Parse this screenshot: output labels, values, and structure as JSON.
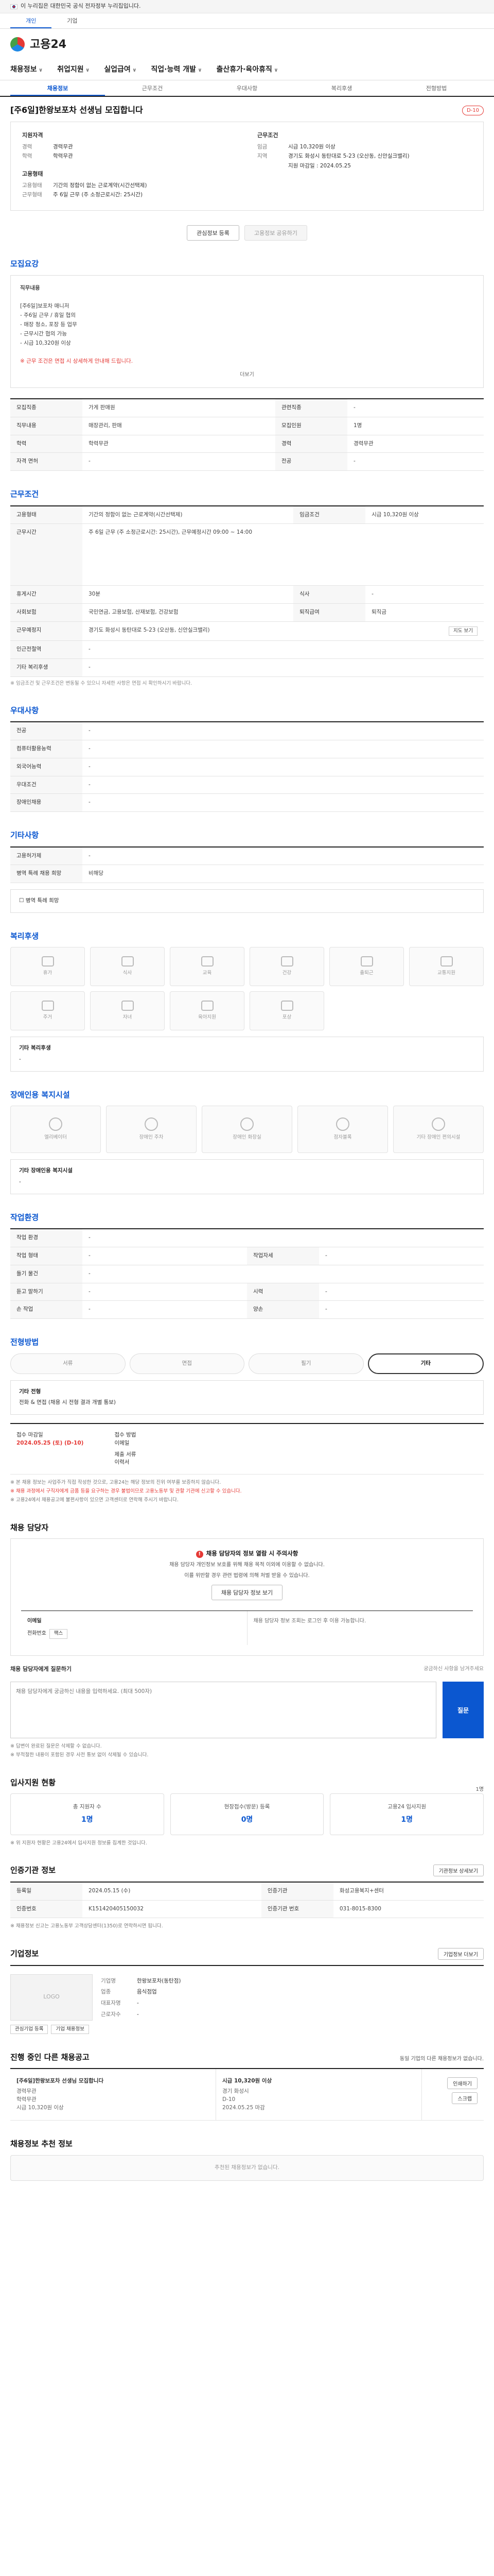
{
  "gov_banner": "이 누리집은 대한민국 공식 전자정부 누리집입니다.",
  "top_tabs": [
    "개인",
    "기업"
  ],
  "logo": "고용24",
  "gnb": [
    "채용정보",
    "취업지원",
    "실업급여",
    "직업·능력 개발",
    "출산휴가·육아휴직"
  ],
  "lnb": [
    "채용정보",
    "근무조건",
    "우대사항",
    "복리후생",
    "전형방법"
  ],
  "job": {
    "title": "[주6일]한왕보포차 선생님 모집합니다",
    "badge": "D-10",
    "company_title": "지원자격",
    "company_rows": [
      {
        "k": "경력",
        "v": "경력무관"
      },
      {
        "k": "학력",
        "v": "학력무관"
      }
    ],
    "work_title": "근무조건",
    "work_rows": [
      {
        "k": "임금",
        "v": "시급 10,320원 이상"
      },
      {
        "k": "지역",
        "v": "경기도 화성시 동탄대로 5-23 (오산동, 신안실크밸리)"
      },
      {
        "k": "",
        "v": "지원 마감일 : 2024.05.25"
      }
    ],
    "type_title": "고용형태",
    "type_rows": [
      {
        "k": "고용형태",
        "v": "기간의 정함이 없는 근로계약(시간선택제)"
      },
      {
        "k": "근무형태",
        "v": "주 6일 근무 (주 소정근로시간: 25시간)"
      }
    ]
  },
  "buttons": {
    "apply": "관심정보 등록",
    "share": "고용정보 공유하기"
  },
  "recruit": {
    "title": "모집요강",
    "desc_title": "직무내용",
    "desc_lines": [
      "[주6일]보포차 매니저",
      "- 주6일 근무 / 휴일 협의",
      "- 매장 청소, 포장 등 업무",
      "- 근무시간 협의 가능",
      "- 시급 10,320원 이상"
    ],
    "desc_note": "※ 근무 조건은 면접 시 상세하게 안내해 드립니다.",
    "more": "더보기",
    "rows": [
      {
        "k1": "모집직종",
        "v1": "가게 판매원",
        "k2": "관련직종",
        "v2": "-"
      },
      {
        "k1": "직무내용",
        "v1": "매장관리, 판매",
        "k2": "모집인원",
        "v2": "1명"
      },
      {
        "k1": "학력",
        "v1": "학력무관",
        "k2": "경력",
        "v2": "경력무관"
      },
      {
        "k1": "자격 면허",
        "v1": "-",
        "k2": "전공",
        "v2": "-"
      }
    ]
  },
  "conditions": {
    "title": "근무조건",
    "rows": [
      {
        "k": "고용형태",
        "v": "기간의 정함이 없는 근로계약(시간선택제)",
        "k2": "임금조건",
        "v2": "시급 10,320원 이상"
      },
      {
        "k": "근무시간",
        "v": "주 6일 근무 (주 소정근로시간: 25시간), 근무예정시간 09:00 ~ 14:00",
        "k2": "",
        "v2": ""
      },
      {
        "k": "휴게시간",
        "v": "30분",
        "k2": "식사",
        "v2": "-"
      },
      {
        "k": "사회보험",
        "v": "국민연금, 고용보험, 산재보험, 건강보험",
        "k2": "퇴직급여",
        "v2": "퇴직금"
      },
      {
        "k": "근무예정지",
        "v": "경기도 화성시 동탄대로 5-23 (오산동, 신안실크밸리)",
        "k2": "",
        "v2": ""
      },
      {
        "k": "인근전철역",
        "v": "-",
        "k2": "",
        "v2": ""
      },
      {
        "k": "기타 복리후생",
        "v": "-",
        "k2": "",
        "v2": ""
      }
    ],
    "map_button": "지도 보기",
    "note": "※ 임금조건 및 근무조건은 변동될 수 있으니 자세한 사항은 면접 시 확인하시기 바랍니다."
  },
  "preferences": {
    "title": "우대사항",
    "rows": [
      {
        "k": "전공",
        "v": "-"
      },
      {
        "k": "컴퓨터활용능력",
        "v": "-"
      },
      {
        "k": "외국어능력",
        "v": "-"
      },
      {
        "k": "우대조건",
        "v": "-"
      },
      {
        "k": "장애인채용",
        "v": "-"
      }
    ]
  },
  "other": {
    "title": "기타사항",
    "rows": [
      {
        "k": "고용허가제",
        "v": "-"
      },
      {
        "k": "병역 특례 채용 희망",
        "v": "비해당"
      }
    ],
    "check": "병역 특례 희망"
  },
  "welfare": {
    "title": "복리후생",
    "items": [
      "휴가",
      "식사",
      "교육",
      "건강",
      "출퇴근",
      "교통지원",
      "주거",
      "자녀",
      "육아지원",
      "포상"
    ],
    "extra_title": "기타 복리후생",
    "extra": "-"
  },
  "disability": {
    "title": "장애인용 복지시설",
    "items": [
      "엘리베이터",
      "장애인 주차",
      "장애인 화장실",
      "점자블록",
      "기타 장애인 편의시설"
    ],
    "extra_title": "기타 장애인용 복지시설",
    "extra": "-"
  },
  "workenv": {
    "title": "작업환경",
    "rows": [
      {
        "k": "작업 환경",
        "v": "-",
        "k2": "",
        "v2": ""
      },
      {
        "k": "작업 형태",
        "v": "-",
        "k2": "작업자세",
        "v2": "-"
      },
      {
        "k": "들기 물건",
        "v": "-",
        "k2": "",
        "v2": ""
      },
      {
        "k": "듣고 말하기",
        "v": "-",
        "k2": "시력",
        "v2": "-"
      },
      {
        "k": "손 작업",
        "v": "-",
        "k2": "양손",
        "v2": "-"
      }
    ]
  },
  "screening": {
    "title": "전형방법",
    "steps": [
      "서류",
      "면접",
      "필기",
      "기타"
    ],
    "method_title": "기타 전형",
    "method": "전화 & 면접 (채용 시 전형 결과 개별 통보)",
    "deadline_label": "접수 마감일",
    "deadline": "2024.05.25 (토) (D-10)",
    "doc_label": "접수 방법",
    "doc": "이메일",
    "docs_label": "제출 서류",
    "docs": "이력서",
    "notes": [
      "※ 본 채용 정보는 사업주가 직접 작성한 것으로, 고용24는 해당 정보의 진위 여부를 보증하지 않습니다.",
      "※ 채용 과정에서 구직자에게 금품 등을 요구하는 경우 불법이므로 고용노동부 및 관할 기관에 신고할 수 있습니다.",
      "※ 고용24에서 채용공고에 불편사항이 있으면 고객센터로 연락해 주시기 바랍니다."
    ]
  },
  "contact": {
    "title": "채용 담당자",
    "warn": "채용 담당자의 정보 열람 시 주의사항",
    "line1": "채용 담당자 개인정보 보호를 위해 채용 목적 이외에 이용할 수 없습니다.",
    "line2": "이를 위반할 경우 관련 법령에 의해 처벌 받을 수 있습니다.",
    "view_button": "채용 담당자 정보 보기",
    "left_label": "이메일",
    "phone_label": "전화번호",
    "fax_label": "팩스",
    "right_text": "채용 담당자 정보 조회는 로그인 후 이용 가능합니다.",
    "inq_title": "채용 담당자에게 질문하기",
    "inq_hint": "궁금하신 사항을 남겨주세요",
    "inq_placeholder": "채용 담당자에게 궁금하신 내용을 입력하세요. (최대 500자)",
    "inq_button": "질문",
    "inq_notes": [
      "※ 답변이 완료된 질문은 삭제할 수 없습니다.",
      "※ 부적절한 내용이 포함된 경우 사전 통보 없이 삭제될 수 있습니다."
    ]
  },
  "applicants": {
    "title": "입사지원 현황",
    "right": "1명",
    "stats": [
      {
        "label": "총 지원자 수",
        "value": "1명"
      },
      {
        "label": "현장접수(방문) 등록",
        "value": "0명"
      },
      {
        "label": "고용24 입사지원",
        "value": "1명"
      }
    ],
    "note": "※ 위 지원자 현황은 고용24에서 입사지원 정보를 집계한 것입니다."
  },
  "agency": {
    "title": "인증기관 정보",
    "button": "기관정보 상세보기",
    "rows": [
      {
        "k": "등록일",
        "v": "2024.05.15 (수)",
        "k2": "인증기관",
        "v2": "화성고용복지+센터"
      },
      {
        "k": "인증번호",
        "v": "K151420405150032",
        "k2": "인증기관 번호",
        "v2": "031-8015-8300"
      }
    ],
    "note": "※ 채용정보 신고는 고용노동부 고객상담센터(1350)로 연락하시면 됩니다."
  },
  "company": {
    "title": "기업정보",
    "logo": "LOGO",
    "button": "기업정보 더보기",
    "rows": [
      {
        "k": "기업명",
        "v": "한왕보포차(동탄점)"
      },
      {
        "k": "업종",
        "v": "음식점업"
      },
      {
        "k": "대표자명",
        "v": "-"
      },
      {
        "k": "근로자수",
        "v": "-"
      }
    ],
    "links": [
      "관심기업 등록",
      "기업 채용정보"
    ]
  },
  "related": {
    "title": "진행 중인 다른 채용공고",
    "subtitle": "동일 기업의 다른 채용정보가 없습니다.",
    "cards": [
      {
        "title": "[주6일]한왕보포차 선생님 모집합니다",
        "lines": [
          "경력무관",
          "학력무관",
          "시급 10,320원 이상"
        ]
      },
      {
        "title": "시급 10,320원 이상",
        "lines": [
          "경기 화성시",
          "D-10",
          "2024.05.25 마감"
        ]
      }
    ],
    "buttons": [
      "인쇄하기",
      "스크랩"
    ]
  },
  "similar": {
    "title": "채용정보 추천 정보",
    "empty": "추천된 채용정보가 없습니다."
  }
}
